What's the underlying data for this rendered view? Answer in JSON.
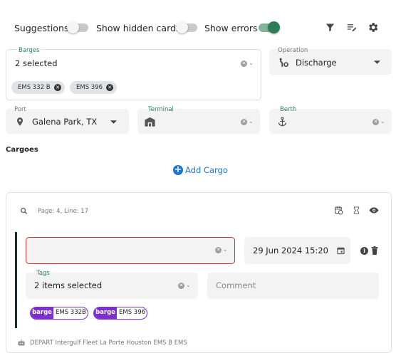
{
  "toolbar": {
    "suggestions_label": "Suggestions",
    "suggestions_on": false,
    "show_hidden_label": "Show hidden cards",
    "show_hidden_on": false,
    "show_errors_label": "Show errors",
    "show_errors_on": true,
    "icons": [
      "filter-icon",
      "edit-list-icon",
      "settings-icon"
    ]
  },
  "barges": {
    "label": "Barges",
    "value": "2 selected",
    "chips": [
      "EMS 332 B",
      "EMS 396"
    ]
  },
  "operation": {
    "label": "Operation",
    "value": "Discharge"
  },
  "port": {
    "label": "Port",
    "value": "Galena Park, TX"
  },
  "terminal": {
    "label": "Terminal",
    "value": ""
  },
  "berth": {
    "label": "Berth",
    "value": ""
  },
  "cargoes": {
    "title": "Cargoes",
    "add_label": "Add Cargo"
  },
  "card": {
    "page_info": "Page: 4, Line: 17",
    "cargo_value": "",
    "datetime": "29 Jun 2024 15:20",
    "tags_label": "Tags",
    "tags_value": "2 items selected",
    "comment_placeholder": "Comment",
    "tag_prefix": "barge",
    "tags": [
      "EMS 332B",
      "EMS 396"
    ],
    "footer": "DEPART Intergulf Fleet La Porte Houston EMS B EMS"
  },
  "colors": {
    "accent_green": "#2e7d57",
    "error_red": "#d32f2f",
    "link_blue": "#1976d2",
    "tag_purple": "#7b2fd0",
    "card_bar": "#10303a"
  }
}
